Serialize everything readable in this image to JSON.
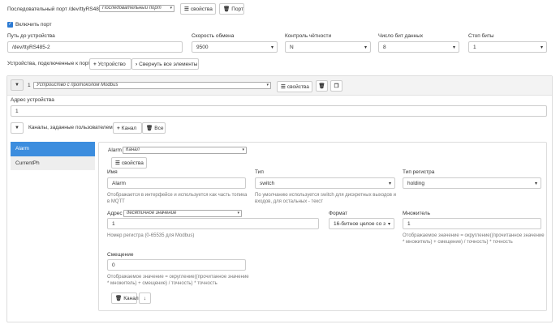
{
  "port": {
    "title": "Последовательный порт /dev/ttyRS485-2",
    "type_select": "Последовательный порт",
    "props_btn": "свойства",
    "delete_btn": "Порт",
    "enable_label": "Включить порт",
    "path_label": "Путь до устройства",
    "path_value": "/dev/ttyRS485-2",
    "baud_label": "Скорость обмена",
    "baud_value": "9500",
    "parity_label": "Контроль чётности",
    "parity_value": "N",
    "databits_label": "Число бит данных",
    "databits_value": "8",
    "stopbits_label": "Стоп биты",
    "stopbits_value": "1",
    "devices_label": "Устройства, подключенные к порту",
    "add_device_btn": "Устройство",
    "collapse_btn": "Свернуть все элементы"
  },
  "device": {
    "index": "1",
    "type_select": "Устройство с протоколом Modbus",
    "props_btn": "свойства",
    "addr_label": "Адрес устройства",
    "addr_value": "1",
    "channels_label": "Каналы, заданные пользователем",
    "add_channel_btn": "Канал",
    "all_btn": "Все"
  },
  "channels": {
    "tabs": [
      "Alarm",
      "CurrentPh"
    ],
    "active": "Alarm",
    "header_name": "Alarm",
    "header_type": "Канал",
    "props_btn": "свойства",
    "name_label": "Имя",
    "name_value": "Alarm",
    "name_help": "Отображается в интерфейсе и используется как часть топика в MQTT",
    "type_label": "Тип",
    "type_value": "switch",
    "type_help": "По умолчанию используется switch для дискретных выходов и входов, для остальных - текст",
    "regtype_label": "Тип регистра",
    "regtype_value": "holding",
    "addr_label": "Адрес",
    "addr_mode": "десятичное значение",
    "addr_value": "1",
    "addr_help": "Номер регистра (0-65535 для Modbus)",
    "format_label": "Формат",
    "format_value": "16-битное целое со з",
    "scale_label": "Множитель",
    "scale_value": "1",
    "scale_help": "Отображаемое значение = округление((прочитанное значение * множитель) + смещение) / точность) * точность",
    "offset_label": "Смещение",
    "offset_value": "0",
    "offset_help": "Отображаемое значение = округление((прочитанное значение * множитель) + смещение) / точность) * точность",
    "delete_btn": "Канал"
  },
  "colors": {
    "accent": "#2b7ad3",
    "active_tab": "#3c8dde",
    "tab_bg": "#eeeeee"
  }
}
